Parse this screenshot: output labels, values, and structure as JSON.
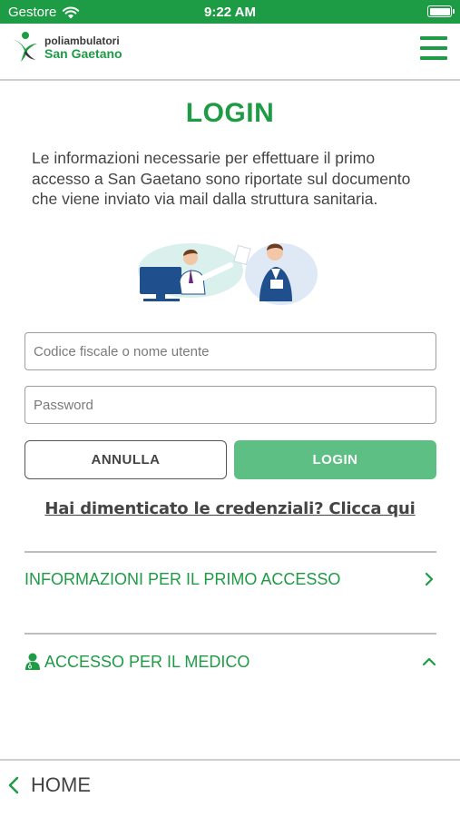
{
  "status_bar": {
    "carrier": "Gestore",
    "time": "9:22 AM"
  },
  "header": {
    "logo_line1": "poliambulatori",
    "logo_line2": "San Gaetano"
  },
  "login": {
    "title": "LOGIN",
    "intro": "Le informazioni necessarie per effettuare il primo accesso a San Gaetano sono riportate sul documento che viene inviato via mail dalla struttura sanitaria.",
    "username_placeholder": "Codice fiscale o nome utente",
    "password_placeholder": "Password",
    "cancel_label": "ANNULLA",
    "login_label": "LOGIN",
    "forgot_label": "Hai dimenticato le credenziali? Clicca qui"
  },
  "sections": {
    "first_access_label": "INFORMAZIONI PER IL PRIMO ACCESSO",
    "doctor_access_label": "ACCESSO PER IL MEDICO"
  },
  "footer": {
    "home_label": "HOME"
  },
  "colors": {
    "brand_green": "#1e9b45",
    "login_button": "#5dbf83"
  }
}
